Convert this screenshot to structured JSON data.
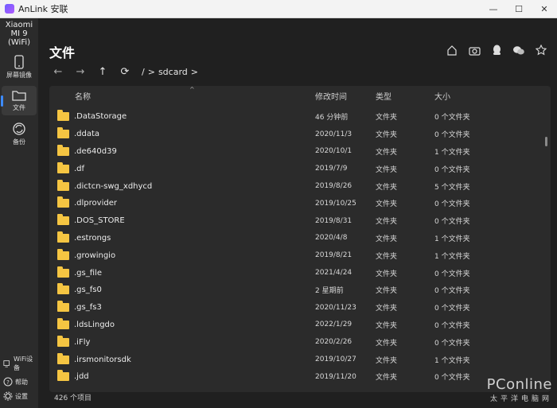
{
  "window": {
    "title": "AnLink 安联",
    "min": "—",
    "max": "☐",
    "close": "✕"
  },
  "sidebar": {
    "device": "Xiaomi MI 9 (WiFi)",
    "items": [
      {
        "label": "屏幕镜像",
        "icon": "phone-icon"
      },
      {
        "label": "文件",
        "icon": "folder-icon",
        "active": true
      },
      {
        "label": "备份",
        "icon": "sync-icon"
      }
    ],
    "bottom": [
      {
        "label": "WiFi设备",
        "icon": "wifi-icon"
      },
      {
        "label": "帮助",
        "icon": "help-icon"
      },
      {
        "label": "设置",
        "icon": "gear-icon"
      }
    ]
  },
  "main": {
    "title": "文件",
    "breadcrumb": {
      "root": "/",
      "sep": ">",
      "folder": "sdcard",
      "trail": ">"
    },
    "columns": {
      "name": "名称",
      "date": "修改时间",
      "type": "类型",
      "size": "大小"
    },
    "rows": [
      {
        "name": ".DataStorage",
        "date": "46 分钟前",
        "type": "文件夹",
        "size": "0 个文件夹"
      },
      {
        "name": ".ddata",
        "date": "2020/11/3",
        "type": "文件夹",
        "size": "0 个文件夹"
      },
      {
        "name": ".de640d39",
        "date": "2020/10/1",
        "type": "文件夹",
        "size": "1 个文件夹"
      },
      {
        "name": ".df",
        "date": "2019/7/9",
        "type": "文件夹",
        "size": "0 个文件夹"
      },
      {
        "name": ".dictcn-swg_xdhycd",
        "date": "2019/8/26",
        "type": "文件夹",
        "size": "5 个文件夹"
      },
      {
        "name": ".dlprovider",
        "date": "2019/10/25",
        "type": "文件夹",
        "size": "0 个文件夹"
      },
      {
        "name": ".DOS_STORE",
        "date": "2019/8/31",
        "type": "文件夹",
        "size": "0 个文件夹"
      },
      {
        "name": ".estrongs",
        "date": "2020/4/8",
        "type": "文件夹",
        "size": "1 个文件夹"
      },
      {
        "name": ".growingio",
        "date": "2019/8/21",
        "type": "文件夹",
        "size": "1 个文件夹"
      },
      {
        "name": ".gs_file",
        "date": "2021/4/24",
        "type": "文件夹",
        "size": "0 个文件夹"
      },
      {
        "name": ".gs_fs0",
        "date": "2 星期前",
        "type": "文件夹",
        "size": "0 个文件夹"
      },
      {
        "name": ".gs_fs3",
        "date": "2020/11/23",
        "type": "文件夹",
        "size": "0 个文件夹"
      },
      {
        "name": ".ldsLingdo",
        "date": "2022/1/29",
        "type": "文件夹",
        "size": "0 个文件夹"
      },
      {
        "name": ".iFly",
        "date": "2020/2/26",
        "type": "文件夹",
        "size": "0 个文件夹"
      },
      {
        "name": ".irsmonitorsdk",
        "date": "2019/10/27",
        "type": "文件夹",
        "size": "1 个文件夹"
      },
      {
        "name": ".jdd",
        "date": "2019/11/20",
        "type": "文件夹",
        "size": "0 个文件夹"
      }
    ],
    "status": "426 个项目"
  },
  "watermark": {
    "brand": "PConline",
    "sub": "太平洋电脑网"
  },
  "colors": {
    "accent": "#3d8bff",
    "folder": "#f5c542",
    "background": "#202020",
    "panel": "#2b2b2b"
  }
}
